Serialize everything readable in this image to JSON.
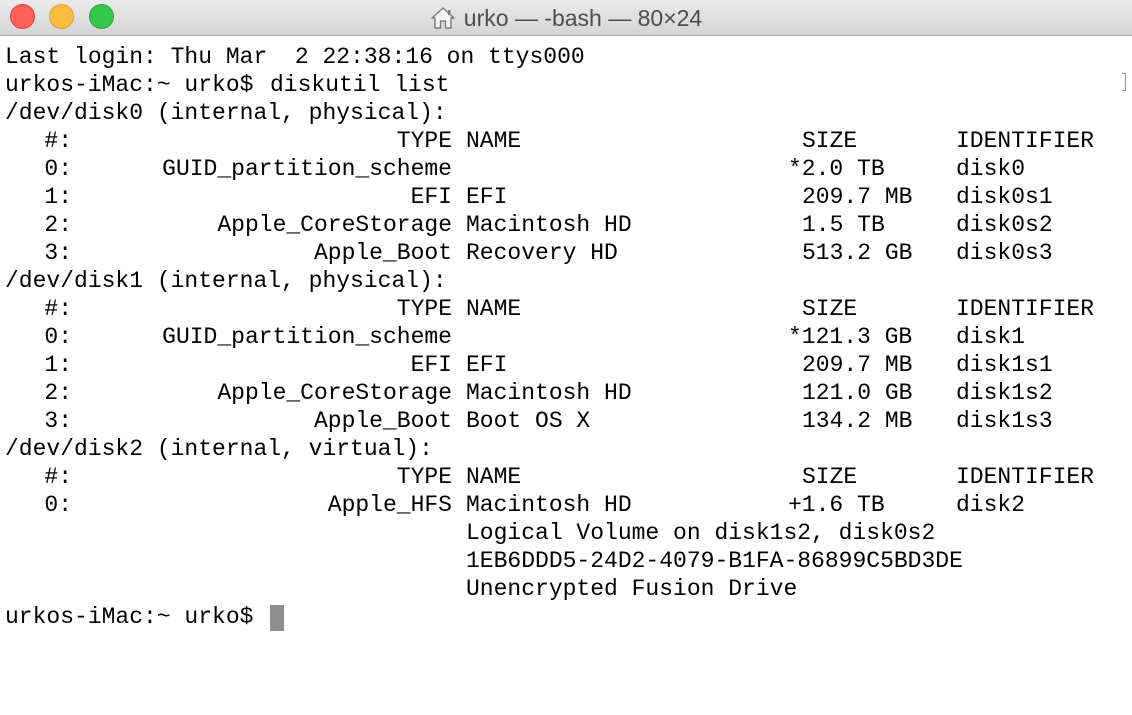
{
  "window": {
    "title": "urko — -bash — 80×24",
    "title_icon": "home-icon"
  },
  "terminal": {
    "login": "Last login: Thu Mar  2 22:38:16 on ttys000",
    "prompt": "urkos-iMac:~ urko$",
    "command": "diskutil list",
    "header": {
      "num": "#:",
      "type": "TYPE",
      "name": "NAME",
      "size": "SIZE",
      "identifier": "IDENTIFIER"
    },
    "disks": [
      {
        "device": "/dev/disk0 (internal, physical):",
        "partitions": [
          {
            "num": "0:",
            "type": "GUID_partition_scheme",
            "name": "",
            "size": "*2.0 TB",
            "identifier": "disk0"
          },
          {
            "num": "1:",
            "type": "EFI",
            "name": "EFI",
            "size": "209.7 MB",
            "identifier": "disk0s1"
          },
          {
            "num": "2:",
            "type": "Apple_CoreStorage",
            "name": "Macintosh HD",
            "size": "1.5 TB",
            "identifier": "disk0s2"
          },
          {
            "num": "3:",
            "type": "Apple_Boot",
            "name": "Recovery HD",
            "size": "513.2 GB",
            "identifier": "disk0s3"
          }
        ]
      },
      {
        "device": "/dev/disk1 (internal, physical):",
        "partitions": [
          {
            "num": "0:",
            "type": "GUID_partition_scheme",
            "name": "",
            "size": "*121.3 GB",
            "identifier": "disk1"
          },
          {
            "num": "1:",
            "type": "EFI",
            "name": "EFI",
            "size": "209.7 MB",
            "identifier": "disk1s1"
          },
          {
            "num": "2:",
            "type": "Apple_CoreStorage",
            "name": "Macintosh HD",
            "size": "121.0 GB",
            "identifier": "disk1s2"
          },
          {
            "num": "3:",
            "type": "Apple_Boot",
            "name": "Boot OS X",
            "size": "134.2 MB",
            "identifier": "disk1s3"
          }
        ]
      },
      {
        "device": "/dev/disk2 (internal, virtual):",
        "partitions": [
          {
            "num": "0:",
            "type": "Apple_HFS",
            "name": "Macintosh HD",
            "size": "+1.6 TB",
            "identifier": "disk2"
          }
        ]
      }
    ],
    "details": [
      "Logical Volume on disk1s2, disk0s2",
      "1EB6DDD5-24D2-4079-B1FA-86899C5BD3DE",
      "Unencrypted Fusion Drive"
    ],
    "final_prompt": "urkos-iMac:~ urko$"
  }
}
